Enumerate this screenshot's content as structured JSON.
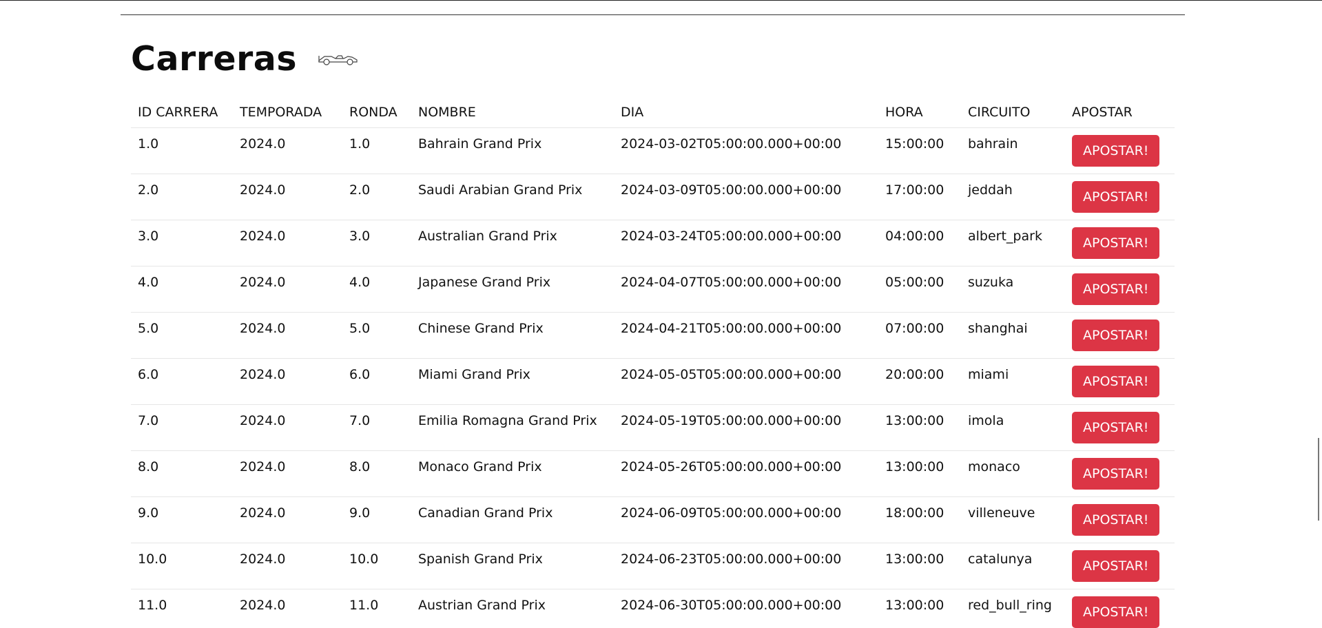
{
  "page": {
    "title": "Carreras",
    "car_icon": "f1-car-icon"
  },
  "table": {
    "headers": [
      "ID CARRERA",
      "TEMPORADA",
      "RONDA",
      "NOMBRE",
      "DIA",
      "HORA",
      "CIRCUITO",
      "APOSTAR"
    ],
    "button_label": "APOSTAR!",
    "rows": [
      [
        "1.0",
        "2024.0",
        "1.0",
        "Bahrain Grand Prix",
        "2024-03-02T05:00:00.000+00:00",
        "15:00:00",
        "bahrain"
      ],
      [
        "2.0",
        "2024.0",
        "2.0",
        "Saudi Arabian Grand Prix",
        "2024-03-09T05:00:00.000+00:00",
        "17:00:00",
        "jeddah"
      ],
      [
        "3.0",
        "2024.0",
        "3.0",
        "Australian Grand Prix",
        "2024-03-24T05:00:00.000+00:00",
        "04:00:00",
        "albert_park"
      ],
      [
        "4.0",
        "2024.0",
        "4.0",
        "Japanese Grand Prix",
        "2024-04-07T05:00:00.000+00:00",
        "05:00:00",
        "suzuka"
      ],
      [
        "5.0",
        "2024.0",
        "5.0",
        "Chinese Grand Prix",
        "2024-04-21T05:00:00.000+00:00",
        "07:00:00",
        "shanghai"
      ],
      [
        "6.0",
        "2024.0",
        "6.0",
        "Miami Grand Prix",
        "2024-05-05T05:00:00.000+00:00",
        "20:00:00",
        "miami"
      ],
      [
        "7.0",
        "2024.0",
        "7.0",
        "Emilia Romagna Grand Prix",
        "2024-05-19T05:00:00.000+00:00",
        "13:00:00",
        "imola"
      ],
      [
        "8.0",
        "2024.0",
        "8.0",
        "Monaco Grand Prix",
        "2024-05-26T05:00:00.000+00:00",
        "13:00:00",
        "monaco"
      ],
      [
        "9.0",
        "2024.0",
        "9.0",
        "Canadian Grand Prix",
        "2024-06-09T05:00:00.000+00:00",
        "18:00:00",
        "villeneuve"
      ],
      [
        "10.0",
        "2024.0",
        "10.0",
        "Spanish Grand Prix",
        "2024-06-23T05:00:00.000+00:00",
        "13:00:00",
        "catalunya"
      ],
      [
        "11.0",
        "2024.0",
        "11.0",
        "Austrian Grand Prix",
        "2024-06-30T05:00:00.000+00:00",
        "13:00:00",
        "red_bull_ring"
      ]
    ]
  },
  "colors": {
    "button": "#dc3545",
    "button_text": "#ffffff"
  }
}
